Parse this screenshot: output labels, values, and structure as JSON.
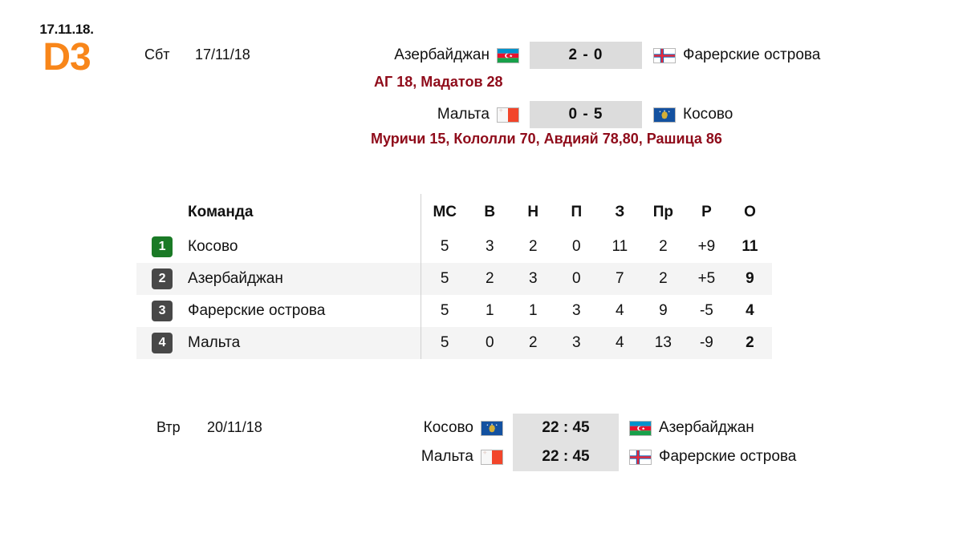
{
  "logo": {
    "date": "17.11.18.",
    "mark": "D3",
    "accent_color": "#f8861a"
  },
  "results": {
    "day_label": "Сбт",
    "date": "17/11/18",
    "matches": [
      {
        "home": "Азербайджан",
        "home_flag": "flag-azerbaijan",
        "score": "2 - 0",
        "away": "Фарерские острова",
        "away_flag": "flag-faroe-islands",
        "scorers": "АГ 18, Мадатов 28"
      },
      {
        "home": "Мальта",
        "home_flag": "flag-malta",
        "score": "0 - 5",
        "away": "Косово",
        "away_flag": "flag-kosovo",
        "scorers": "Муричи 15, Кололли 70, Авдияй 78,80, Рашица 86"
      }
    ],
    "scorer_color": "#8f0b1a"
  },
  "standings": {
    "headers": {
      "rank": "",
      "team": "Команда",
      "stats": [
        "МС",
        "В",
        "Н",
        "П",
        "З",
        "Пр",
        "Р",
        "О"
      ]
    },
    "rows": [
      {
        "rank": "1",
        "rank_style": "green",
        "team": "Косово",
        "played": "5",
        "wins": "3",
        "draws": "2",
        "losses": "0",
        "goals_for": "11",
        "goals_against": "2",
        "goal_diff": "+9",
        "points": "11"
      },
      {
        "rank": "2",
        "rank_style": "grey",
        "team": "Азербайджан",
        "played": "5",
        "wins": "2",
        "draws": "3",
        "losses": "0",
        "goals_for": "7",
        "goals_against": "2",
        "goal_diff": "+5",
        "points": "9"
      },
      {
        "rank": "3",
        "rank_style": "grey",
        "team": "Фарерские острова",
        "played": "5",
        "wins": "1",
        "draws": "1",
        "losses": "3",
        "goals_for": "4",
        "goals_against": "9",
        "goal_diff": "-5",
        "points": "4"
      },
      {
        "rank": "4",
        "rank_style": "grey",
        "team": "Мальта",
        "played": "5",
        "wins": "0",
        "draws": "2",
        "losses": "3",
        "goals_for": "4",
        "goals_against": "13",
        "goal_diff": "-9",
        "points": "2"
      }
    ],
    "rank_colors": {
      "green": "#1a7a26",
      "grey": "#484848"
    }
  },
  "fixtures": {
    "day_label": "Втр",
    "date": "20/11/18",
    "matches": [
      {
        "home": "Косово",
        "home_flag": "flag-kosovo",
        "time": "22 : 45",
        "away": "Азербайджан",
        "away_flag": "flag-azerbaijan"
      },
      {
        "home": "Мальта",
        "home_flag": "flag-malta",
        "time": "22 : 45",
        "away": "Фарерские острова",
        "away_flag": "flag-faroe-islands"
      }
    ]
  }
}
